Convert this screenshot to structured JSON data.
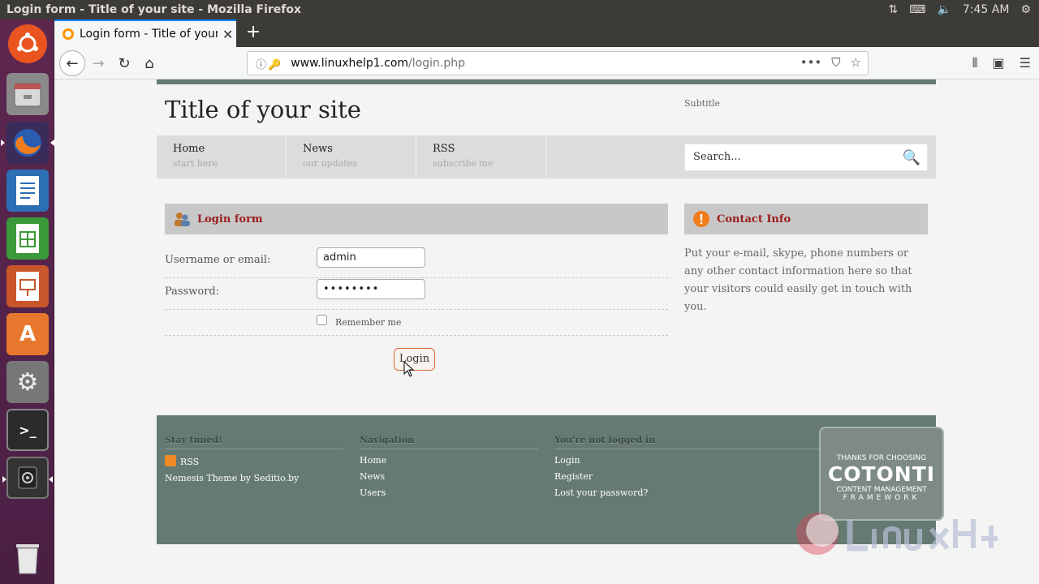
{
  "system": {
    "window_title": "Login form - Title of your site - Mozilla Firefox",
    "clock": "7:45 AM"
  },
  "browser": {
    "tab_title": "Login form - Title of your site",
    "url_host": "www.linuxhelp1.com",
    "url_path": "/login.php"
  },
  "site": {
    "title": "Title of your site",
    "subtitle": "Subtitle",
    "menu": [
      {
        "label": "Home",
        "sub": "start here"
      },
      {
        "label": "News",
        "sub": "our updates"
      },
      {
        "label": "RSS",
        "sub": "subscribe me"
      }
    ],
    "search_placeholder": "Search..."
  },
  "login_form": {
    "heading": "Login form",
    "username_label": "Username or email:",
    "username_value": "admin",
    "password_label": "Password:",
    "password_value": "••••••••",
    "remember_label": "Remember me",
    "submit_label": "Login"
  },
  "contact": {
    "heading": "Contact Info",
    "text": "Put your e-mail, skype, phone numbers or any other contact information here so that your visitors could easily get in touch with you."
  },
  "footer": {
    "col1": {
      "heading": "Stay tuned!",
      "links": [
        "RSS",
        "Nemesis Theme by Seditio.by"
      ]
    },
    "col2": {
      "heading": "Navigation",
      "links": [
        "Home",
        "News",
        "Users"
      ]
    },
    "col3": {
      "heading": "You're not logged in",
      "links": [
        "Login",
        "Register",
        "Lost your password?"
      ]
    },
    "badge": {
      "line1": "THANKS FOR CHOOSING",
      "line2": "COTONTI",
      "line3": "CONTENT MANAGEMENT",
      "line4": "FRAMEWORK"
    }
  },
  "colors": {
    "accent": "#9b1b1b",
    "footer_bg": "#657a72",
    "launcher_bg": "#5e2750"
  }
}
